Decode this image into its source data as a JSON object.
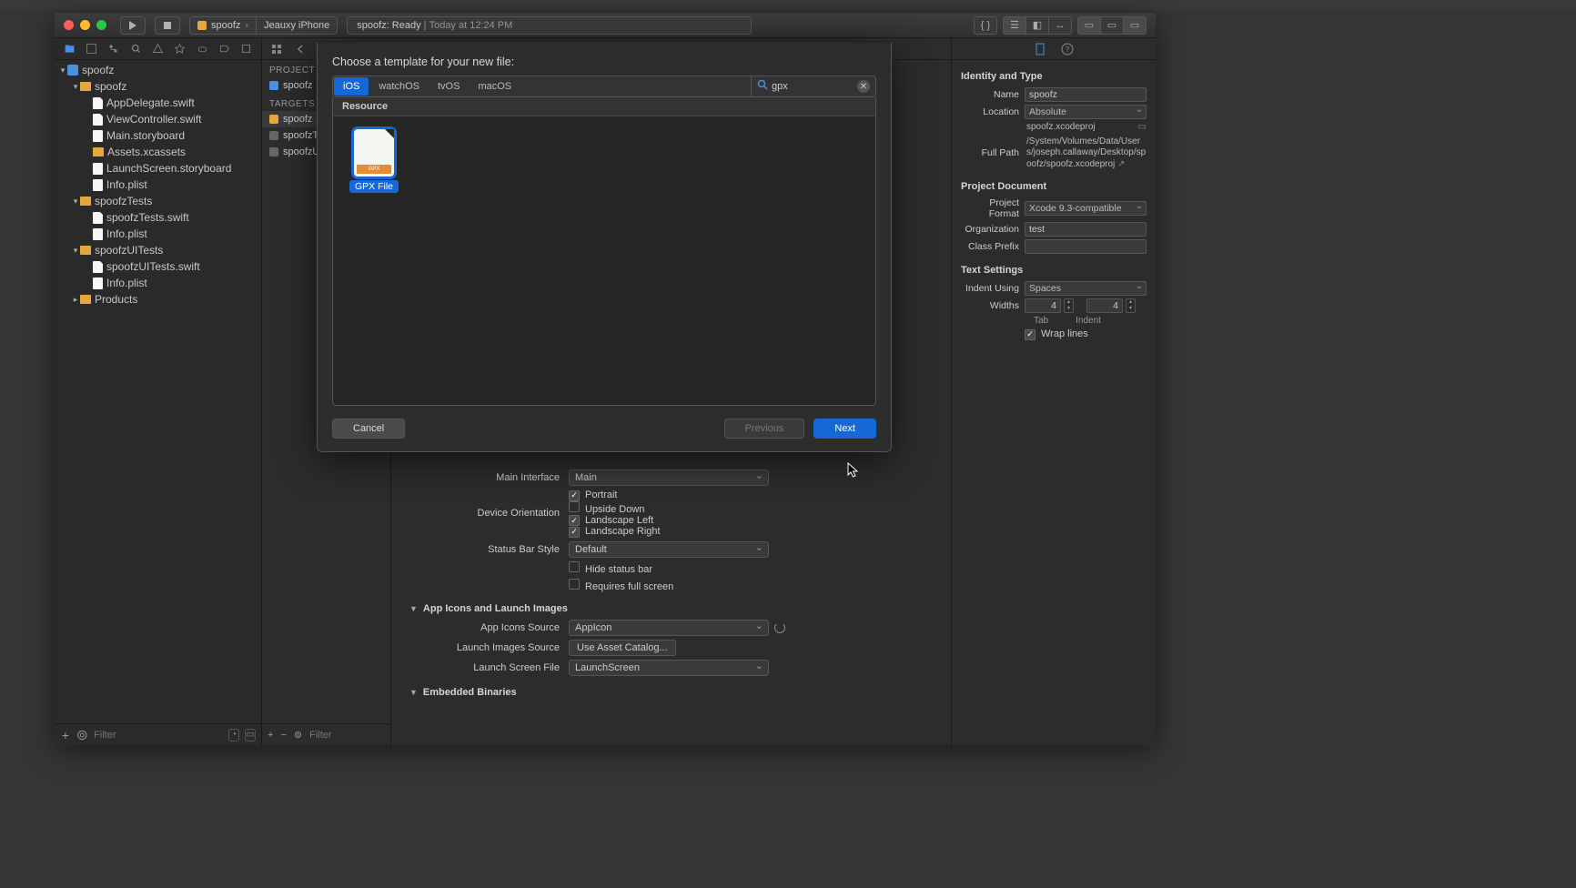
{
  "toolbar": {
    "scheme_name": "spoofz",
    "scheme_device": "Jeauxy iPhone",
    "status_prefix": "spoofz:",
    "status_state": "Ready",
    "status_time": "Today at 12:24 PM"
  },
  "navigator": {
    "root": "spoofz",
    "groups": [
      {
        "name": "spoofz",
        "items": [
          "AppDelegate.swift",
          "ViewController.swift",
          "Main.storyboard",
          "Assets.xcassets",
          "LaunchScreen.storyboard",
          "Info.plist"
        ]
      },
      {
        "name": "spoofzTests",
        "items": [
          "spoofzTests.swift",
          "Info.plist"
        ]
      },
      {
        "name": "spoofzUITests",
        "items": [
          "spoofzUITests.swift",
          "Info.plist"
        ]
      }
    ],
    "products": "Products",
    "filter_placeholder": "Filter"
  },
  "target_list": {
    "project_hdr": "PROJECT",
    "project_name": "spoofz",
    "targets_hdr": "TARGETS",
    "targets": [
      "spoofz",
      "spoofzTests",
      "spoofzUITests"
    ],
    "filter_placeholder": "Filter"
  },
  "settings": {
    "main_interface_label": "Main Interface",
    "main_interface_value": "Main",
    "device_orientation_label": "Device Orientation",
    "orientations": [
      {
        "label": "Portrait",
        "checked": true
      },
      {
        "label": "Upside Down",
        "checked": false
      },
      {
        "label": "Landscape Left",
        "checked": true
      },
      {
        "label": "Landscape Right",
        "checked": true
      }
    ],
    "status_bar_label": "Status Bar Style",
    "status_bar_value": "Default",
    "hide_status_bar": {
      "label": "Hide status bar",
      "checked": false
    },
    "requires_full_screen": {
      "label": "Requires full screen",
      "checked": false
    },
    "app_icons_section": "App Icons and Launch Images",
    "app_icons_source_label": "App Icons Source",
    "app_icons_source_value": "AppIcon",
    "launch_images_source_label": "Launch Images Source",
    "launch_images_button": "Use Asset Catalog...",
    "launch_screen_label": "Launch Screen File",
    "launch_screen_value": "LaunchScreen",
    "embedded_binaries_section": "Embedded Binaries"
  },
  "inspector": {
    "identity_section": "Identity and Type",
    "name_label": "Name",
    "name_value": "spoofz",
    "location_label": "Location",
    "location_value": "Absolute",
    "location_filename": "spoofz.xcodeproj",
    "full_path_label": "Full Path",
    "full_path_value": "/System/Volumes/Data/Users/joseph.callaway/Desktop/spoofz/spoofz.xcodeproj",
    "project_doc_section": "Project Document",
    "project_format_label": "Project Format",
    "project_format_value": "Xcode 9.3-compatible",
    "organization_label": "Organization",
    "organization_value": "test",
    "class_prefix_label": "Class Prefix",
    "class_prefix_value": "",
    "text_settings_section": "Text Settings",
    "indent_using_label": "Indent Using",
    "indent_using_value": "Spaces",
    "widths_label": "Widths",
    "tab_value": "4",
    "tab_label": "Tab",
    "indent_value": "4",
    "indent_label": "Indent",
    "wrap_lines_label": "Wrap lines"
  },
  "sheet": {
    "title": "Choose a template for your new file:",
    "platforms": [
      "iOS",
      "watchOS",
      "tvOS",
      "macOS"
    ],
    "search_value": "gpx",
    "category": "Resource",
    "template_name": "GPX File",
    "cancel": "Cancel",
    "previous": "Previous",
    "next": "Next"
  }
}
